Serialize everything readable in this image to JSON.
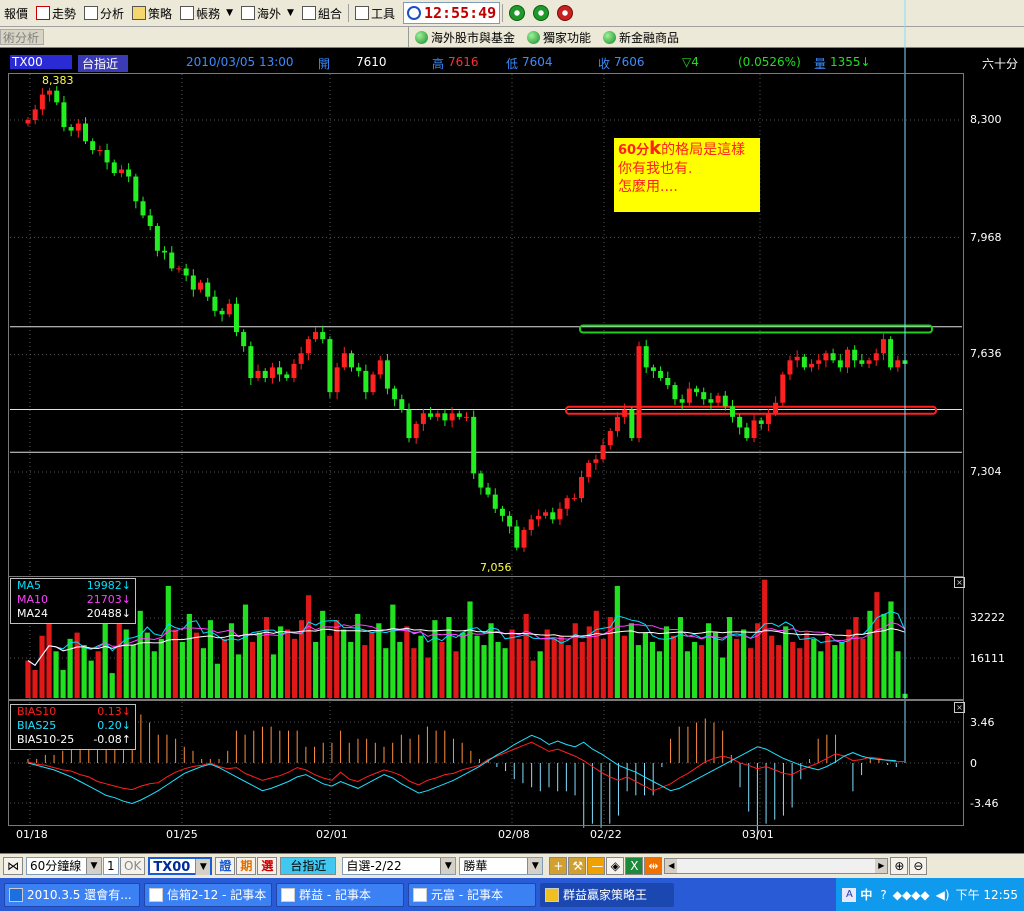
{
  "toolbar": {
    "items": [
      {
        "label": "報價",
        "icon": "quote-icon"
      },
      {
        "label": "走勢",
        "icon": "trend-icon"
      },
      {
        "label": "分析",
        "icon": "analysis-icon"
      },
      {
        "label": "策略",
        "icon": "strategy-icon"
      },
      {
        "label": "帳務",
        "icon": "account-icon",
        "dropdown": true
      },
      {
        "label": "海外",
        "icon": "overseas-icon",
        "dropdown": true
      },
      {
        "label": "組合",
        "icon": "combo-icon"
      },
      {
        "label": "工具",
        "icon": "tools-icon"
      }
    ],
    "clock": "12:55:49",
    "round_buttons": [
      {
        "name": "green-circle-button",
        "color": "#1f9a2a"
      },
      {
        "name": "green-circle-button-2",
        "color": "#1f9a2a"
      },
      {
        "name": "red-circle-button",
        "color": "#c62020"
      }
    ]
  },
  "subbar": {
    "tab": "術分析",
    "links": [
      "海外股市與基金",
      "獨家功能",
      "新金融商品"
    ]
  },
  "infobar": {
    "symbol": "TX00",
    "name": "台指近",
    "datetime": "2010/03/05 13:00",
    "open_label": "開",
    "open_value": "7610",
    "high_label": "高",
    "high_value": "7616",
    "low_label": "低",
    "low_value": "7604",
    "close_label": "收",
    "close_value": "7606",
    "change": "▽4",
    "change_pct": "(0.0526%)",
    "volume_label": "量",
    "volume_value": "1355↓",
    "period": "六十分"
  },
  "price_panel": {
    "y_ticks": [
      "8,300",
      "7,968",
      "7,636",
      "7,304"
    ],
    "high_mark": "8,383",
    "low_mark": "7,056",
    "annotation": {
      "line1_a": "60分",
      "line1_b": "k",
      "line1_c": "的格局是這樣",
      "line2": "你有我也有.",
      "line3": "怎麼用...."
    }
  },
  "volume_panel": {
    "y_ticks": [
      "32222",
      "16111"
    ],
    "legend": [
      {
        "name": "MA5",
        "value": "19982↓",
        "color": "#00e0ff"
      },
      {
        "name": "MA10",
        "value": "21703↓",
        "color": "#ff40ff"
      },
      {
        "name": "MA24",
        "value": "20488↓",
        "color": "#ffffff"
      }
    ]
  },
  "bias_panel": {
    "y_ticks": [
      "3.46",
      "0",
      "-3.46"
    ],
    "legend": [
      {
        "name": "BIAS10",
        "value": "0.13↓",
        "color": "#ff2020"
      },
      {
        "name": "BIAS25",
        "value": "0.20↓",
        "color": "#20e0ff"
      },
      {
        "name": "BIAS10-25",
        "value": "-0.08↑",
        "color": "#ffffff"
      }
    ]
  },
  "x_labels": [
    "01/18",
    "01/25",
    "02/01",
    "02/08",
    "02/22",
    "03/01"
  ],
  "bottombar": {
    "period_select": "60分鐘線",
    "period_count": "1",
    "ok_label": "OK",
    "symbol_input": "TX00",
    "type_buttons": [
      "證",
      "期",
      "選"
    ],
    "name_button": "台指近",
    "watchlist_select": "自選-2/22",
    "broker_select": "勝華"
  },
  "taskbar": {
    "start_label": "2010.3.5 還會有...",
    "tasks": [
      "信箱2-12 - 記事本",
      "群益 - 記事本",
      "元富 - 記事本",
      "群益贏家策略王"
    ],
    "ime": "中",
    "time": "下午 12:55"
  },
  "chart_data": {
    "type": "candlestick",
    "interval": "60 minutes",
    "x_axis_labels": [
      "01/18",
      "01/25",
      "02/01",
      "02/08",
      "02/22",
      "03/01"
    ],
    "price_ticks": [
      8300,
      7968,
      7636,
      7304
    ],
    "ylim": [
      7000,
      8420
    ],
    "marked_high": 8383,
    "marked_low": 7056,
    "horizontal_levels": [
      7715,
      7481,
      7360
    ],
    "annotated_levels": [
      {
        "value": 7710,
        "color": "#22cc22"
      },
      {
        "value": 7480,
        "color": "#ff2020"
      }
    ],
    "last_bar": {
      "open": 7610,
      "high": 7616,
      "low": 7604,
      "close": 7606
    },
    "close_path": [
      8300,
      8330,
      8372,
      8383,
      8350,
      8280,
      8270,
      8290,
      8240,
      8215,
      8215,
      8180,
      8150,
      8160,
      8140,
      8070,
      8030,
      8000,
      7930,
      7925,
      7880,
      7880,
      7860,
      7820,
      7840,
      7800,
      7760,
      7750,
      7780,
      7700,
      7660,
      7570,
      7590,
      7570,
      7600,
      7580,
      7570,
      7610,
      7640,
      7680,
      7700,
      7680,
      7530,
      7600,
      7640,
      7600,
      7590,
      7530,
      7580,
      7620,
      7540,
      7510,
      7480,
      7400,
      7440,
      7470,
      7460,
      7470,
      7450,
      7470,
      7460,
      7460,
      7300,
      7260,
      7240,
      7200,
      7180,
      7150,
      7090,
      7140,
      7170,
      7180,
      7190,
      7170,
      7200,
      7230,
      7230,
      7290,
      7330,
      7340,
      7380,
      7420,
      7460,
      7480,
      7400,
      7660,
      7600,
      7590,
      7570,
      7550,
      7510,
      7500,
      7540,
      7530,
      7510,
      7500,
      7520,
      7490,
      7460,
      7430,
      7400,
      7450,
      7440,
      7470,
      7500,
      7580,
      7620,
      7630,
      7600,
      7610,
      7620,
      7640,
      7620,
      7600,
      7650,
      7620,
      7610,
      7620,
      7640,
      7680,
      7600,
      7620,
      7610
    ],
    "volume_ticks": [
      32222,
      16111
    ],
    "volume": [
      12000,
      9000,
      20000,
      26000,
      15000,
      9000,
      19000,
      21000,
      17000,
      12000,
      15000,
      24000,
      8000,
      26000,
      22000,
      17000,
      28000,
      21000,
      15000,
      19000,
      36000,
      22000,
      18000,
      27000,
      21000,
      16000,
      25000,
      11000,
      19000,
      24000,
      14000,
      30000,
      18000,
      21000,
      26000,
      14000,
      23000,
      22000,
      19000,
      25000,
      33000,
      18000,
      28000,
      20000,
      25000,
      22000,
      18000,
      27000,
      17000,
      21000,
      24000,
      16000,
      30000,
      18000,
      23000,
      16000,
      20000,
      13000,
      25000,
      18000,
      26000,
      15000,
      21000,
      31000,
      20000,
      17000,
      24000,
      18000,
      16000,
      22000,
      19000,
      27000,
      12000,
      15000,
      22000,
      19000,
      20000,
      17000,
      24000,
      18000,
      23000,
      28000,
      19000,
      26000,
      36000,
      20000,
      24000,
      17000,
      21000,
      18000,
      15000,
      23000,
      20000,
      26000,
      15000,
      18000,
      17000,
      24000,
      21000,
      13000,
      26000,
      19000,
      22000,
      16000,
      24000,
      38000,
      20000,
      17000,
      23000,
      18000,
      16000,
      21000,
      19000,
      15000,
      20000,
      17000,
      18000,
      22000,
      26000,
      19000,
      28000,
      34000,
      27000,
      31000,
      15000,
      1355
    ],
    "bias_ticks": [
      3.46,
      0,
      -3.46
    ],
    "bias10": [
      0.1,
      -0.1,
      -0.2,
      -0.4,
      -0.6,
      -0.7,
      -1.0,
      -1.2,
      -1.6,
      -1.8,
      -2.0,
      -2.2,
      -2.3,
      -2.0,
      -1.8,
      -1.7,
      -1.2,
      -0.8,
      -0.5,
      -0.3,
      -0.2,
      0.0,
      -0.3,
      -0.5,
      -0.4,
      -0.9,
      -1.2,
      -1.5,
      -1.3,
      -1.1,
      -0.8,
      -0.4,
      -0.6,
      -1.0,
      -1.3,
      -1.5,
      -0.8,
      -1.4,
      -1.6,
      -1.2,
      -0.9,
      -0.6,
      -0.8,
      -1.1,
      -1.6,
      -1.9,
      -1.5,
      -1.3,
      -1.0,
      -0.9,
      -0.6,
      -0.4,
      -0.2,
      0.3,
      0.6,
      0.9,
      1.2,
      1.5,
      1.8,
      1.4,
      1.0,
      1.2,
      0.9,
      0.6,
      0.2,
      -0.3,
      -0.8,
      -1.2,
      -1.5,
      -1.2,
      -1.6,
      -2.0,
      -2.4,
      -2.1,
      -1.8,
      -1.3,
      -0.9,
      -0.4,
      0.1,
      0.4,
      0.6,
      0.4,
      0.0,
      -0.2,
      -0.5,
      -0.3,
      -0.6,
      -0.9,
      -1.0,
      -0.6,
      -0.3,
      0.0,
      0.4,
      0.8,
      0.6,
      0.2,
      0.3,
      0.5,
      0.4,
      0.2,
      0.1,
      0.13
    ],
    "bias25": [
      0.0,
      -0.2,
      -0.4,
      -0.6,
      -0.9,
      -1.2,
      -1.6,
      -2.0,
      -2.4,
      -2.8,
      -3.0,
      -3.3,
      -3.5,
      -3.2,
      -2.8,
      -2.4,
      -1.9,
      -1.4,
      -0.9,
      -0.6,
      -0.3,
      -0.1,
      -0.4,
      -0.8,
      -1.2,
      -1.6,
      -2.0,
      -2.4,
      -2.2,
      -1.9,
      -1.6,
      -1.2,
      -1.0,
      -1.4,
      -1.8,
      -2.0,
      -1.6,
      -1.9,
      -2.2,
      -1.8,
      -1.4,
      -1.0,
      -1.3,
      -1.8,
      -2.2,
      -2.6,
      -2.4,
      -2.1,
      -1.8,
      -1.5,
      -1.1,
      -0.7,
      -0.3,
      0.2,
      0.7,
      1.1,
      1.6,
      2.0,
      2.4,
      2.1,
      1.6,
      1.9,
      1.6,
      1.4,
      1.8,
      1.2,
      0.8,
      0.3,
      -0.2,
      -0.5,
      -0.8,
      -1.2,
      -1.6,
      -2.0,
      -2.4,
      -2.2,
      -1.8,
      -1.4,
      -1.0,
      -0.6,
      -0.2,
      0.2,
      0.6,
      1.0,
      1.4,
      1.2,
      0.8,
      0.4,
      0.1,
      -0.2,
      -0.4,
      -0.6,
      -0.3,
      0.1,
      0.6,
      0.9,
      0.6,
      0.4,
      0.3,
      0.25,
      0.2
    ]
  }
}
